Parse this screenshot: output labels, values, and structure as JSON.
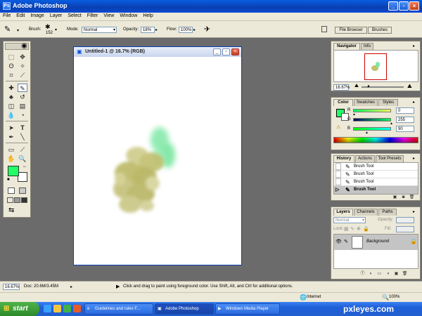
{
  "window": {
    "title": "Adobe Photoshop"
  },
  "menu": [
    "File",
    "Edit",
    "Image",
    "Layer",
    "Select",
    "Filter",
    "View",
    "Window",
    "Help"
  ],
  "options": {
    "brush_label": "Brush:",
    "brush_size": "152",
    "mode_label": "Mode:",
    "mode_value": "Normal",
    "opacity_label": "Opacity:",
    "opacity_value": "18%",
    "flow_label": "Flow:",
    "flow_value": "100%",
    "tabs": [
      "File Browser",
      "Brushes"
    ]
  },
  "document": {
    "title": "Untitled-1 @ 16.7% (RGB)"
  },
  "navigator": {
    "tabs": [
      "Navigator",
      "Info"
    ],
    "zoom": "16.67%"
  },
  "color": {
    "tabs": [
      "Color",
      "Swatches",
      "Styles"
    ],
    "r_label": "R",
    "r_value": "0",
    "g_label": "G",
    "g_value": "255",
    "b_label": "B",
    "b_value": "90"
  },
  "history": {
    "tabs": [
      "History",
      "Actions",
      "Tool Presets"
    ],
    "items": [
      "Brush Tool",
      "Brush Tool",
      "Brush Tool",
      "Brush Tool"
    ]
  },
  "layers": {
    "tabs": [
      "Layers",
      "Channels",
      "Paths"
    ],
    "blend": "Normal",
    "opacity_label": "Opacity:",
    "fill_label": "Fill:",
    "lock_label": "Lock:",
    "layer_name": "Background"
  },
  "status": {
    "zoom": "16.67%",
    "doc": "Doc: 20.6M/3.45M",
    "hint": "Click and drag to paint using foreground color. Use Shift, Alt, and Ctrl for additional options."
  },
  "browser_strip": {
    "zone": "Internet",
    "zoom": "100%"
  },
  "taskbar": {
    "start": "start",
    "items": [
      "Guidelines and rules F...",
      "Adobe Photoshop",
      "Windows Media Player"
    ],
    "clock": "pxleyes.com"
  },
  "colors": {
    "foreground": "#22ff66",
    "background": "#ffffff",
    "accent": "#0a4ad6"
  }
}
